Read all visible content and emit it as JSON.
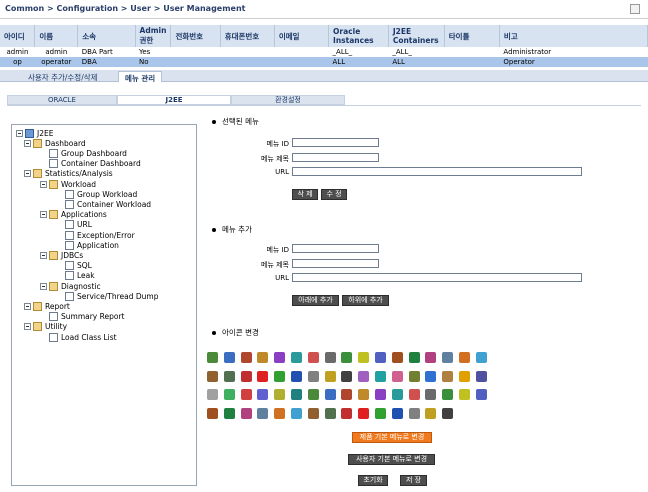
{
  "breadcrumb": "Common > Configuration > User > User Management",
  "table": {
    "headers": [
      "아이디",
      "이름",
      "소속",
      "Admin\n권한",
      "전화번호",
      "휴대폰번호",
      "이메일",
      "Oracle\nInstances",
      "J2EE\nContainers",
      "타이틀",
      "비고"
    ],
    "rows": [
      [
        "admin",
        "admin",
        "DBA Part",
        "Yes",
        "",
        "",
        "",
        "_ALL_",
        "_ALL_",
        "",
        "Administrator"
      ],
      [
        "op",
        "operator",
        "DBA",
        "No",
        "",
        "",
        "",
        "ALL",
        "ALL",
        "",
        "Operator"
      ]
    ]
  },
  "top_tabs": [
    "사용자 추가/수정/삭제",
    "메뉴 관리"
  ],
  "sub_tabs": [
    "ORACLE",
    "J2EE",
    "환경설정"
  ],
  "tree": [
    {
      "label": "J2EE",
      "level": 0,
      "icon": "root"
    },
    {
      "label": "Dashboard",
      "level": 1,
      "icon": "folder"
    },
    {
      "label": "Group Dashboard",
      "level": 2,
      "icon": "doc"
    },
    {
      "label": "Container Dashboard",
      "level": 2,
      "icon": "doc"
    },
    {
      "label": "Statistics/Analysis",
      "level": 1,
      "icon": "folder"
    },
    {
      "label": "Workload",
      "level": 2,
      "icon": "folder"
    },
    {
      "label": "Group Workload",
      "level": 3,
      "icon": "doc"
    },
    {
      "label": "Container Workload",
      "level": 3,
      "icon": "doc"
    },
    {
      "label": "Applications",
      "level": 2,
      "icon": "folder"
    },
    {
      "label": "URL",
      "level": 3,
      "icon": "doc"
    },
    {
      "label": "Exception/Error",
      "level": 3,
      "icon": "doc"
    },
    {
      "label": "Application",
      "level": 3,
      "icon": "doc"
    },
    {
      "label": "JDBCs",
      "level": 2,
      "icon": "folder"
    },
    {
      "label": "SQL",
      "level": 3,
      "icon": "doc"
    },
    {
      "label": "Leak",
      "level": 3,
      "icon": "doc"
    },
    {
      "label": "Diagnostic",
      "level": 2,
      "icon": "folder"
    },
    {
      "label": "Service/Thread Dump",
      "level": 3,
      "icon": "doc"
    },
    {
      "label": "Report",
      "level": 1,
      "icon": "folder"
    },
    {
      "label": "Summary Report",
      "level": 2,
      "icon": "doc"
    },
    {
      "label": "Utility",
      "level": 1,
      "icon": "folder"
    },
    {
      "label": "Load Class List",
      "level": 2,
      "icon": "doc"
    }
  ],
  "selected_menu": {
    "title": "선택된 메뉴",
    "id_label": "메뉴 ID",
    "name_label": "메뉴 제목",
    "url_label": "URL",
    "delete_btn": "삭 제",
    "edit_btn": "수 정"
  },
  "add_menu": {
    "title": "메뉴 추가",
    "id_label": "메뉴 ID",
    "name_label": "메뉴 제목",
    "url_label": "URL",
    "add_below_btn": "아래에 추가",
    "add_child_btn": "하위에 추가"
  },
  "icon_change": {
    "title": "아이콘 변경"
  },
  "bottom_buttons": {
    "product_default": "제품 기본 메뉴로 변경",
    "user_default": "사용자 기본 메뉴로 변경",
    "reset": "초기화",
    "save": "저 장"
  },
  "colors": {
    "header_bg": "#d8e3f2",
    "selected_row": "#a9c6ea",
    "orange_button": "#f07a1e",
    "gray_button": "#4e4e4e"
  },
  "icon_palette": [
    "#4a8a3a",
    "#3b6ec2",
    "#b0462e",
    "#c08a2a",
    "#8a3ec2",
    "#2a9a9a",
    "#d05050",
    "#6a6a6a",
    "#3b8e3b",
    "#c0c020",
    "#5060c0",
    "#a05020",
    "#208040",
    "#b04080",
    "#6080a0",
    "#d07020",
    "#40a0d0",
    "#906030",
    "#507050",
    "#c03030",
    "#e02020",
    "#30a030",
    "#2050b0",
    "#808080",
    "#c0a020",
    "#404040",
    "#a060c0",
    "#20a0a0",
    "#d06090",
    "#708030",
    "#3070d0",
    "#b08040",
    "#e0a000",
    "#5050a0",
    "#a0a0a0",
    "#40b060",
    "#d04040",
    "#6060d0",
    "#b0b030",
    "#208080"
  ]
}
